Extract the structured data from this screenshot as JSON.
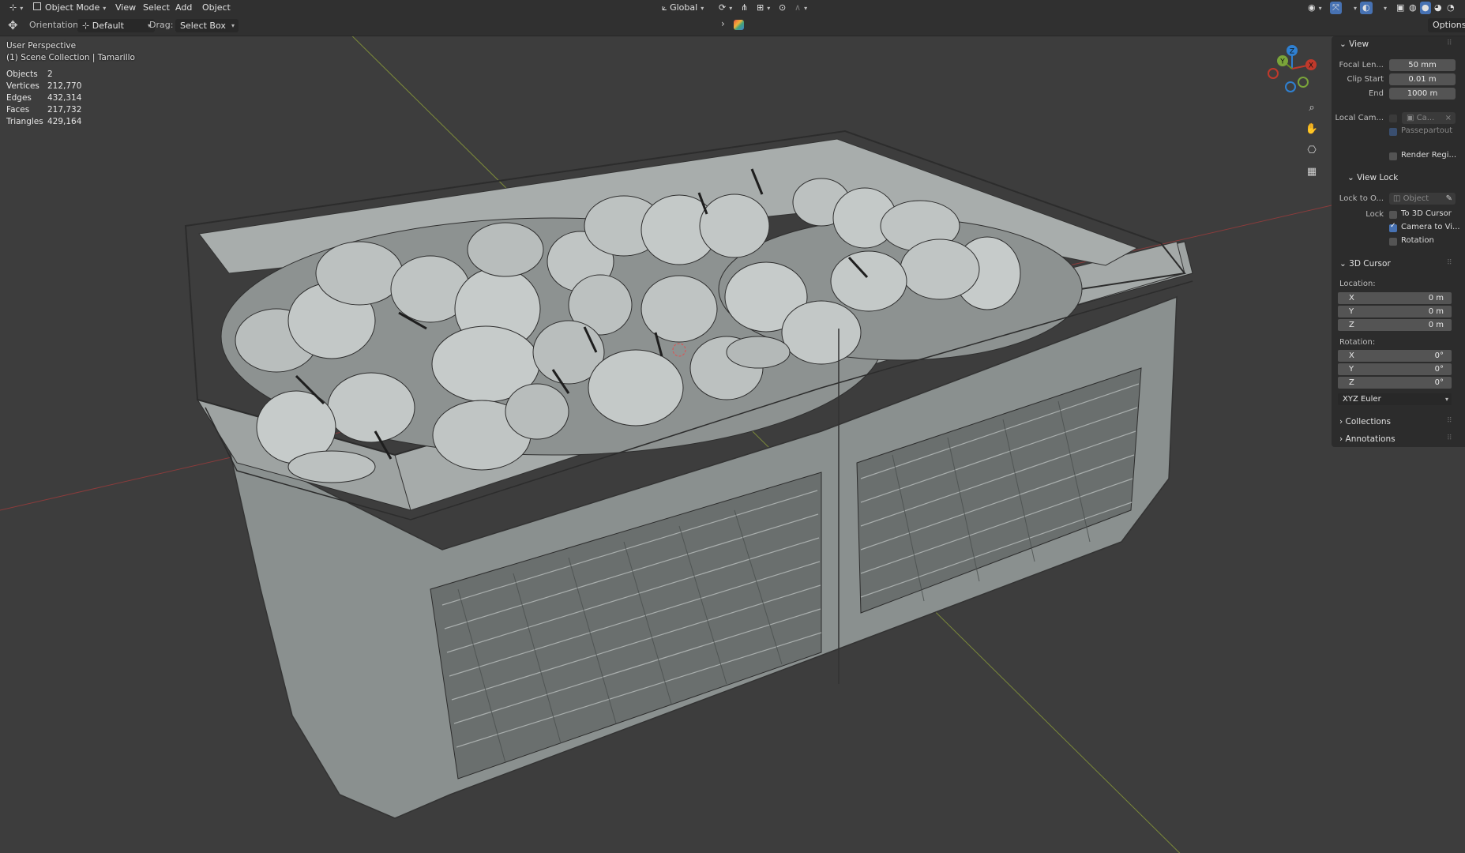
{
  "header": {
    "mode": "Object Mode",
    "menu": [
      "View",
      "Select",
      "Add",
      "Object"
    ],
    "transform_orientation": "Global"
  },
  "toolbar": {
    "orientation_label": "Orientation:",
    "orientation_value": "Default",
    "drag_label": "Drag:",
    "drag_value": "Select Box",
    "options": "Options"
  },
  "viewport": {
    "perspective": "User Perspective",
    "collection": "(1) Scene Collection | Tamarillo",
    "stats": [
      {
        "label": "Objects",
        "value": "2"
      },
      {
        "label": "Vertices",
        "value": "212,770"
      },
      {
        "label": "Edges",
        "value": "432,314"
      },
      {
        "label": "Faces",
        "value": "217,732"
      },
      {
        "label": "Triangles",
        "value": "429,164"
      }
    ],
    "gizmo": {
      "x": "X",
      "y": "Y",
      "z": "Z"
    }
  },
  "sidebar": {
    "view": {
      "title": "View",
      "focal_label": "Focal Len...",
      "focal_value": "50 mm",
      "clip_start_label": "Clip Start",
      "clip_start_value": "0.01 m",
      "end_label": "End",
      "end_value": "1000 m",
      "local_cam_label": "Local Cam...",
      "local_cam_value": "Ca...",
      "passepartout": "Passepartout",
      "render_region": "Render Regi..."
    },
    "view_lock": {
      "title": "View Lock",
      "lock_to_label": "Lock to O...",
      "lock_to_placeholder": "Object",
      "lock_label": "Lock",
      "to_cursor": "To 3D Cursor",
      "camera_to_view": "Camera to Vi...",
      "rotation": "Rotation"
    },
    "cursor": {
      "title": "3D Cursor",
      "location_label": "Location:",
      "location": [
        {
          "k": "X",
          "v": "0 m"
        },
        {
          "k": "Y",
          "v": "0 m"
        },
        {
          "k": "Z",
          "v": "0 m"
        }
      ],
      "rotation_label": "Rotation:",
      "rotation": [
        {
          "k": "X",
          "v": "0°"
        },
        {
          "k": "Y",
          "v": "0°"
        },
        {
          "k": "Z",
          "v": "0°"
        }
      ],
      "rotation_mode": "XYZ Euler"
    },
    "collections": "Collections",
    "annotations": "Annotations"
  },
  "colors": {
    "accent": "#4772b3",
    "x_axis": "#c0392b",
    "y_axis": "#6b8e23",
    "z_axis": "#2f80d1"
  }
}
